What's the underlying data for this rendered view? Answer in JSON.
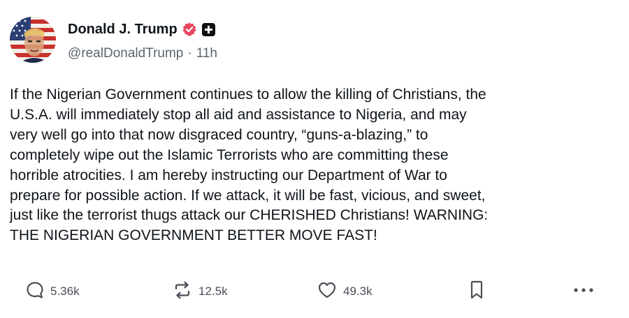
{
  "author": {
    "display_name": "Donald J. Trump",
    "handle": "@realDonaldTrump",
    "separator": "·",
    "time_ago": "11h",
    "verified_badge_icon": "verified-badge-icon",
    "verified_color": "#e8475f",
    "plus_badge_icon": "plus-square-icon"
  },
  "post": {
    "text": "If the Nigerian Government continues to allow the killing of Christians, the\nU.S.A. will immediately stop all aid and assistance to Nigeria, and may\nvery well go into that now disgraced country, “guns-a-blazing,” to\ncompletely wipe out the Islamic Terrorists who are committing these\nhorrible atrocities. I am hereby instructing our Department of War to\nprepare for possible action. If we attack, it will be fast, vicious, and sweet,\njust like the terrorist thugs attack our CHERISHED Christians! WARNING:\nTHE NIGERIAN GOVERNMENT BETTER MOVE FAST!"
  },
  "actions": {
    "reply": {
      "icon": "reply-icon",
      "count": "5.36k"
    },
    "repost": {
      "icon": "repost-icon",
      "count": "12.5k"
    },
    "like": {
      "icon": "heart-icon",
      "count": "49.3k"
    },
    "bookmark": {
      "icon": "bookmark-icon"
    },
    "more": {
      "icon": "more-dots-icon"
    }
  }
}
